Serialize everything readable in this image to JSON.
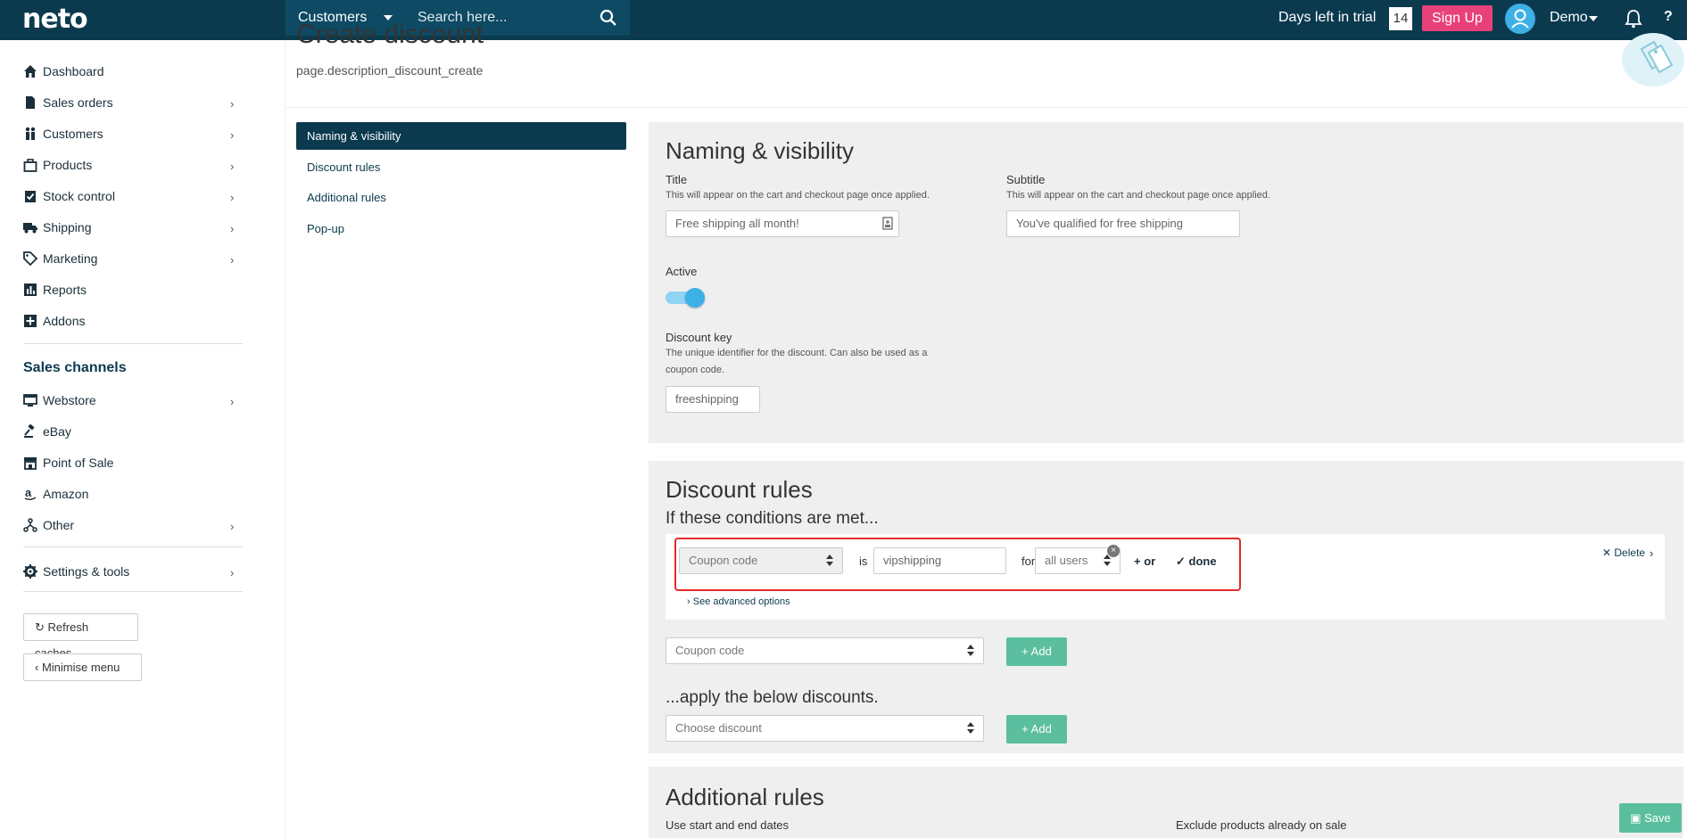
{
  "topbar": {
    "logo": "neto",
    "search_category": "Customers",
    "search_placeholder": "Search here...",
    "trial_label": "Days left in trial",
    "trial_days": "14",
    "signup_label": "Sign Up",
    "user_name": "Demo",
    "help_label": "?"
  },
  "sidebar": {
    "items": [
      {
        "label": "Dashboard",
        "icon": "home-icon",
        "has_children": false
      },
      {
        "label": "Sales orders",
        "icon": "document-icon",
        "has_children": true
      },
      {
        "label": "Customers",
        "icon": "people-icon",
        "has_children": true
      },
      {
        "label": "Products",
        "icon": "box-icon",
        "has_children": true
      },
      {
        "label": "Stock control",
        "icon": "clipboard-check-icon",
        "has_children": true
      },
      {
        "label": "Shipping",
        "icon": "truck-icon",
        "has_children": true
      },
      {
        "label": "Marketing",
        "icon": "tag-icon",
        "has_children": true
      },
      {
        "label": "Reports",
        "icon": "bar-chart-icon",
        "has_children": false
      },
      {
        "label": "Addons",
        "icon": "plus-square-icon",
        "has_children": false
      }
    ],
    "channels_heading": "Sales channels",
    "channels": [
      {
        "label": "Webstore",
        "icon": "monitor-icon",
        "has_children": true
      },
      {
        "label": "eBay",
        "icon": "gavel-icon",
        "has_children": false
      },
      {
        "label": "Point of Sale",
        "icon": "store-icon",
        "has_children": false
      },
      {
        "label": "Amazon",
        "icon": "amazon-icon",
        "has_children": false
      },
      {
        "label": "Other",
        "icon": "sitemap-icon",
        "has_children": true
      }
    ],
    "settings_label": "Settings & tools",
    "refresh_label": "Refresh caches",
    "minimise_label": "Minimise menu"
  },
  "header": {
    "title": "Create discount",
    "description": "page.description_discount_create"
  },
  "subnav": {
    "items": [
      "Naming & visibility",
      "Discount rules",
      "Additional rules",
      "Pop-up"
    ],
    "active_index": 0
  },
  "naming": {
    "title": "Naming & visibility",
    "title_label": "Title",
    "title_help": "This will appear on the cart and checkout page once applied.",
    "title_placeholder": "Free shipping all month!",
    "subtitle_label": "Subtitle",
    "subtitle_help": "This will appear on the cart and checkout page once applied.",
    "subtitle_placeholder": "You've qualified for free shipping",
    "active_label": "Active",
    "active_on": true,
    "key_label": "Discount key",
    "key_help": "The unique identifier for the discount. Can also be used as a coupon code.",
    "key_value": "freeshipping"
  },
  "rules": {
    "title": "Discount rules",
    "conditions_heading": "If these conditions are met...",
    "condition": {
      "field": "Coupon code",
      "operator": "is",
      "value": "vipshipping",
      "for_label": "for",
      "audience": "all users",
      "or_label": "+ or",
      "done_label": "done",
      "delete_label": "Delete",
      "advanced_label": "See advanced options"
    },
    "new_condition_select": "Coupon code",
    "add_label": "Add",
    "apply_heading": "...apply the below discounts.",
    "discount_select": "Choose discount"
  },
  "additional": {
    "title": "Additional rules",
    "dates_label": "Use start and end dates",
    "exclude_label": "Exclude products already on sale"
  },
  "save_label": "Save",
  "colors": {
    "topbar": "#0b3a4e",
    "accent_pink": "#e8417a",
    "toggle_blue": "#3db0e6",
    "add_green": "#5bbf9f",
    "highlight_red": "#e32b2b"
  }
}
